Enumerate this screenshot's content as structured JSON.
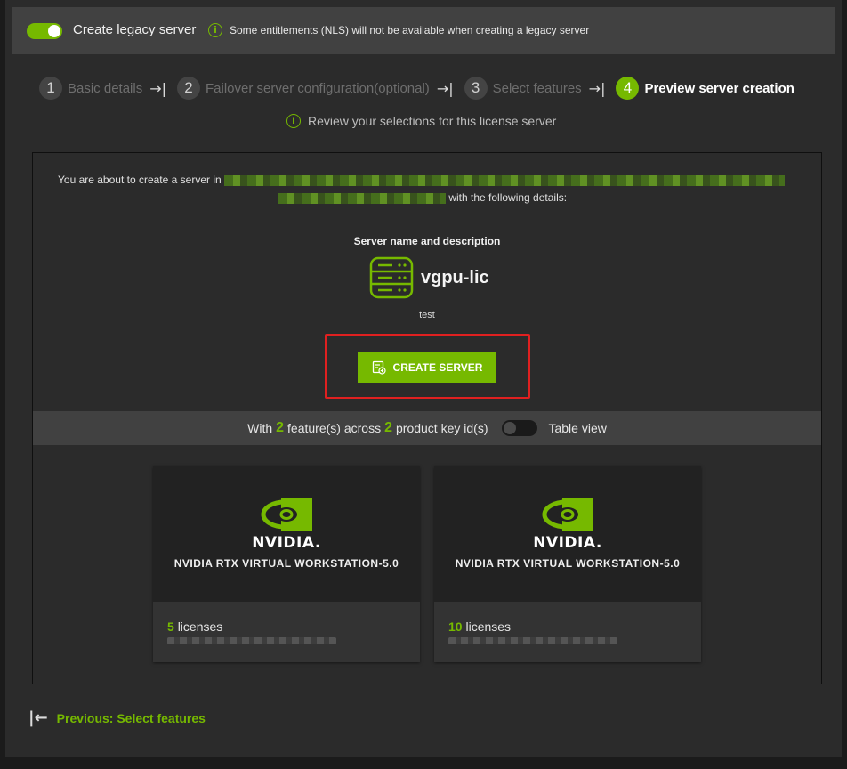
{
  "header": {
    "title": "Create legacy server",
    "info": "Some entitlements (NLS) will not be available when creating a legacy server",
    "toggle_state": "on"
  },
  "stepper": {
    "steps": [
      {
        "num": "1",
        "label": "Basic details"
      },
      {
        "num": "2",
        "label": "Failover server configuration(optional)"
      },
      {
        "num": "3",
        "label": "Select features"
      },
      {
        "num": "4",
        "label": "Preview server creation"
      }
    ],
    "active_step": 4
  },
  "review_text": "Review your selections for this license server",
  "intro": {
    "prefix": "You are about to create a server in",
    "suffix": "with the following details:"
  },
  "server": {
    "section_title": "Server name and description",
    "name": "vgpu-lic",
    "description": "test"
  },
  "create_button": "CREATE SERVER",
  "features_bar": {
    "prefix": "With",
    "feature_count": "2",
    "mid": "feature(s) across",
    "product_key_count": "2",
    "suffix": "product key id(s)",
    "table_view_label": "Table view"
  },
  "cards": [
    {
      "logo": "NVIDIA.",
      "title": "NVIDIA RTX VIRTUAL WORKSTATION-5.0",
      "license_count": "5",
      "license_label": "licenses"
    },
    {
      "logo": "NVIDIA.",
      "title": "NVIDIA RTX VIRTUAL WORKSTATION-5.0",
      "license_count": "10",
      "license_label": "licenses"
    }
  ],
  "previous_link": "Previous: Select features",
  "colors": {
    "accent": "#76b900",
    "highlight": "#e02020"
  }
}
